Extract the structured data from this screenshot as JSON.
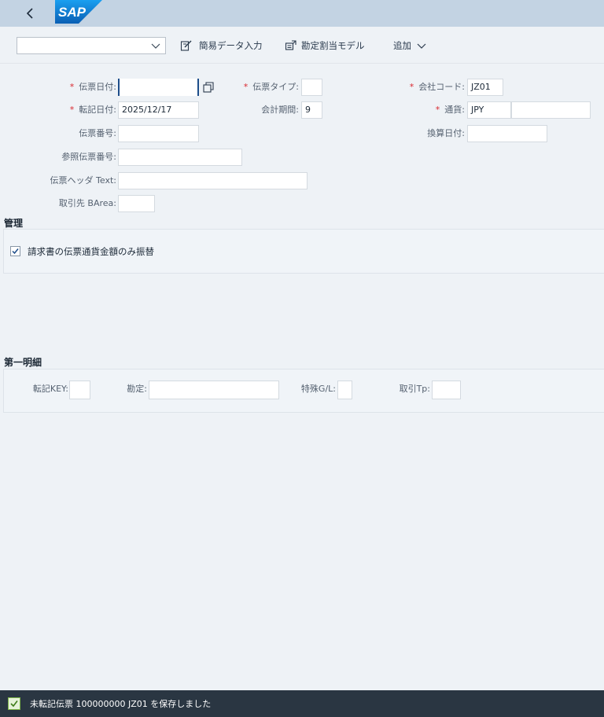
{
  "header": {
    "logo_text": "SAP"
  },
  "toolbar": {
    "variant_value": "",
    "easy_entry_label": "簡易データ入力",
    "account_model_label": "勘定割当モデル",
    "add_label": "追加"
  },
  "form": {
    "doc_date": {
      "label": "伝票日付:",
      "value": ""
    },
    "doc_type": {
      "label": "伝票タイプ:",
      "value": ""
    },
    "company_code": {
      "label": "会社コード:",
      "value": "JZ01"
    },
    "posting_date": {
      "label": "転記日付:",
      "value": "2025/12/17"
    },
    "fiscal_period": {
      "label": "会計期間:",
      "value": "9"
    },
    "currency": {
      "label": "通貨:",
      "value": "JPY",
      "value2": ""
    },
    "doc_number": {
      "label": "伝票番号:",
      "value": ""
    },
    "translation_date": {
      "label": "換算日付:",
      "value": ""
    },
    "ref_doc_number": {
      "label": "参照伝票番号:",
      "value": ""
    },
    "header_text": {
      "label": "伝票ヘッダ Text:",
      "value": ""
    },
    "partner_barea": {
      "label": "取引先 BArea:",
      "value": ""
    }
  },
  "management": {
    "title": "管理",
    "checkbox_label": "請求書の伝票通貨金額のみ振替",
    "checked": true
  },
  "first_line": {
    "title": "第一明細",
    "posting_key": {
      "label": "転記KEY:",
      "value": ""
    },
    "account": {
      "label": "勘定:",
      "value": ""
    },
    "special_gl": {
      "label": "特殊G/L:",
      "value": ""
    },
    "trans_type": {
      "label": "取引Tp:",
      "value": ""
    }
  },
  "status": {
    "message": "未転記伝票 100000000 JZ01 を保存しました",
    "type": "success"
  },
  "colors": {
    "shell": "#c3d3e3",
    "background": "#eef2f6",
    "statusbar": "#2a3642",
    "required": "#d9272e",
    "sap_blue": "#1873cc"
  }
}
